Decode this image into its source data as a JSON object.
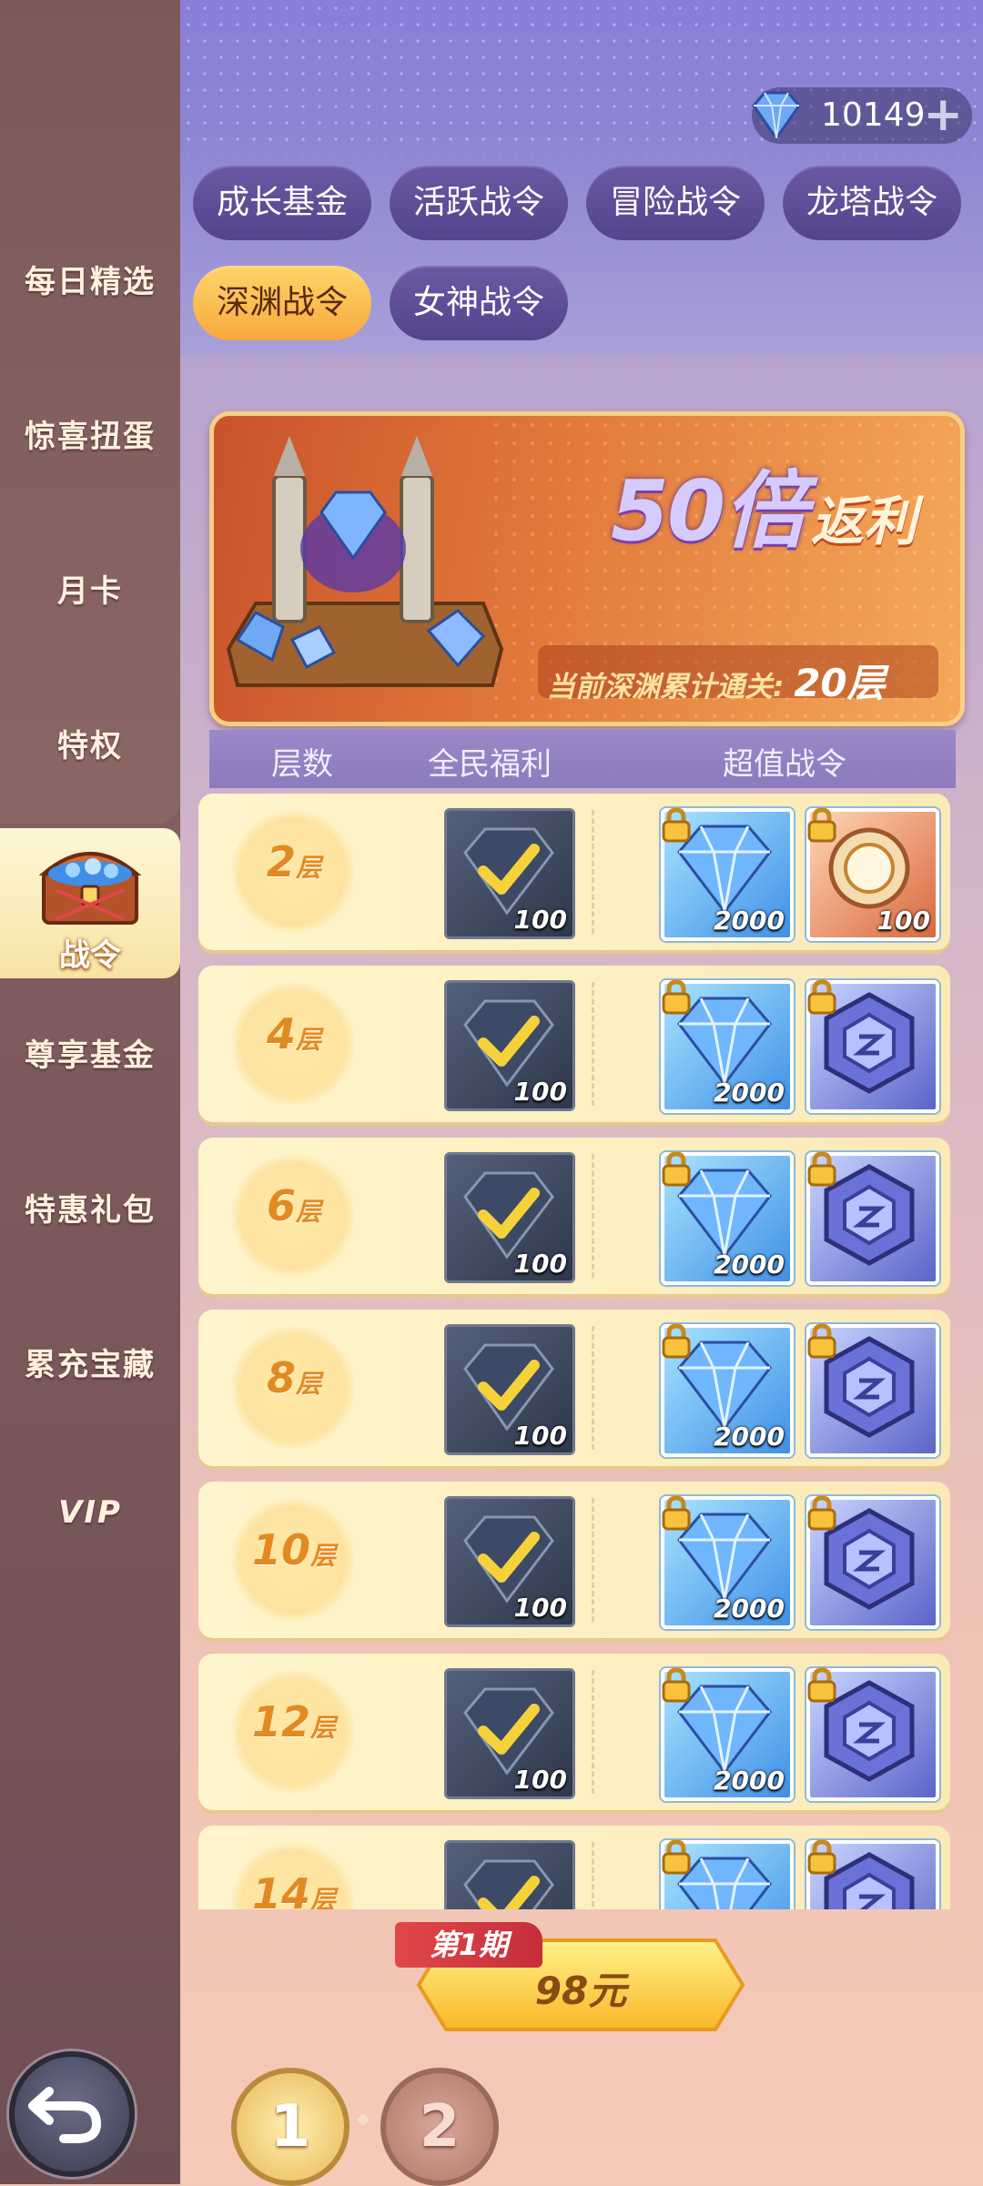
{
  "sidebar": {
    "items": [
      {
        "label": "每日精选"
      },
      {
        "label": "惊喜扭蛋"
      },
      {
        "label": "月卡"
      },
      {
        "label": "特权"
      },
      {
        "label": "战令",
        "active": true
      },
      {
        "label": "尊享基金"
      },
      {
        "label": "特惠礼包"
      },
      {
        "label": "累充宝藏"
      },
      {
        "label": "VIP"
      }
    ]
  },
  "currency": {
    "amount": "10149",
    "icon": "diamond-icon"
  },
  "tabs": [
    {
      "label": "成长基金"
    },
    {
      "label": "活跃战令"
    },
    {
      "label": "冒险战令"
    },
    {
      "label": "龙塔战令"
    },
    {
      "label": "深渊战令",
      "active": true
    },
    {
      "label": "女神战令"
    }
  ],
  "banner": {
    "multiplier": "50倍",
    "word": "返利",
    "progress_label": "当前深渊累计通关:",
    "progress_value": "20层"
  },
  "table": {
    "headers": {
      "floor": "层数",
      "free": "全民福利",
      "premium": "超值战令"
    },
    "rows": [
      {
        "floor": "2",
        "unit": "层",
        "free_qty": "100",
        "gem_qty": "2000",
        "special_qty": "100"
      },
      {
        "floor": "4",
        "unit": "层",
        "free_qty": "100",
        "gem_qty": "2000",
        "special_qty": ""
      },
      {
        "floor": "6",
        "unit": "层",
        "free_qty": "100",
        "gem_qty": "2000",
        "special_qty": ""
      },
      {
        "floor": "8",
        "unit": "层",
        "free_qty": "100",
        "gem_qty": "2000",
        "special_qty": ""
      },
      {
        "floor": "10",
        "unit": "层",
        "free_qty": "100",
        "gem_qty": "2000",
        "special_qty": ""
      },
      {
        "floor": "12",
        "unit": "层",
        "free_qty": "100",
        "gem_qty": "2000",
        "special_qty": ""
      },
      {
        "floor": "14",
        "unit": "层",
        "free_qty": "",
        "gem_qty": "",
        "special_qty": ""
      }
    ]
  },
  "purchase": {
    "period": "第1期",
    "price": "98元"
  },
  "pages": {
    "current": "1",
    "next": "2"
  },
  "colors": {
    "accent": "#f7a93c",
    "tab_bg": "#53448c",
    "row_bg": "#fdf0c2",
    "floor_text": "#e28a22"
  }
}
